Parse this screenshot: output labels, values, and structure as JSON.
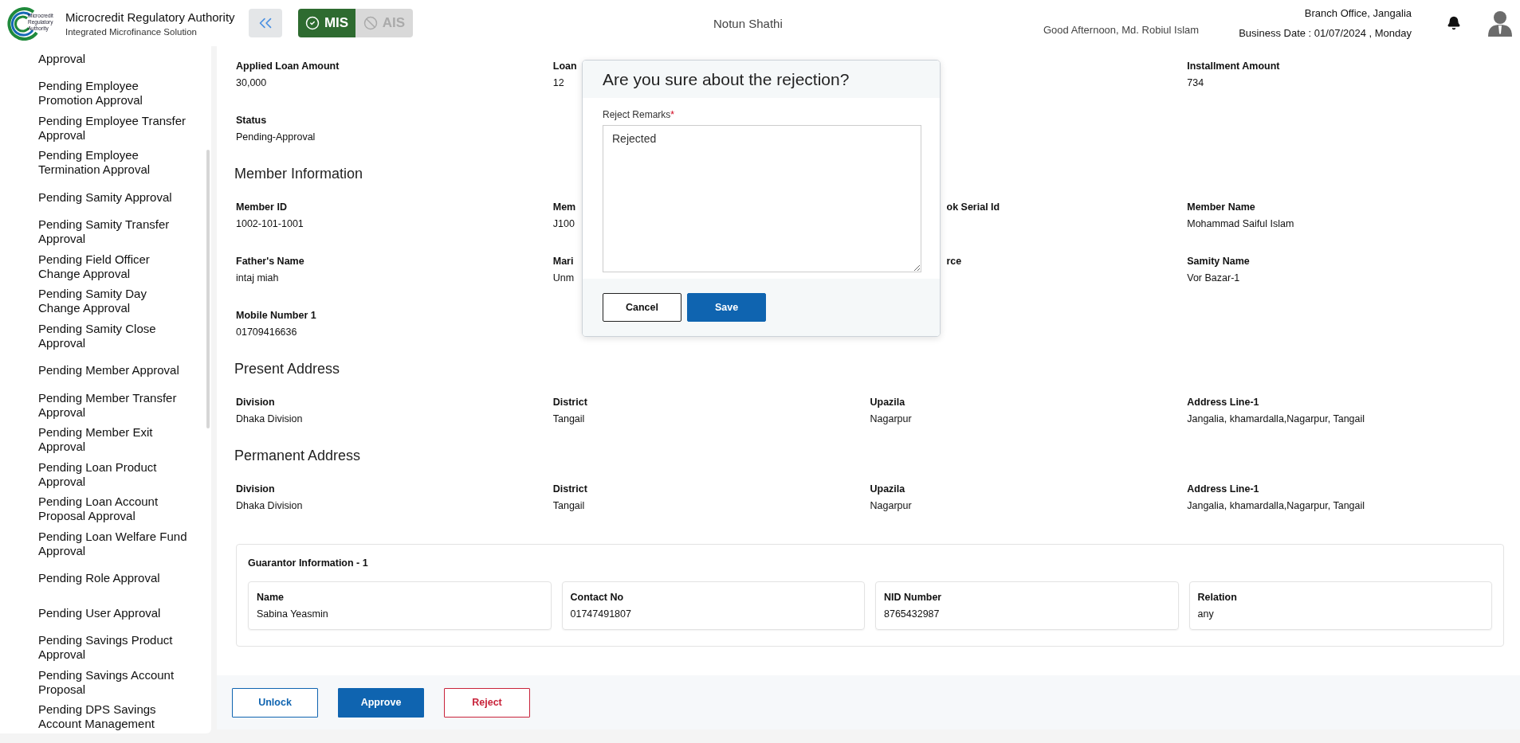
{
  "header": {
    "logo_text": "Microcredit Regulatory Authority",
    "title": "Microcredit Regulatory Authority",
    "subtitle": "Integrated Microfinance Solution",
    "modules": [
      {
        "label": "MIS",
        "selected": true
      },
      {
        "label": "AIS",
        "selected": false
      }
    ],
    "center_title": "Notun Shathi",
    "greeting": "Good Afternoon, Md. Robiul Islam",
    "branch": "Branch Office, Jangalia",
    "business_date": "Business Date : 01/07/2024 , Monday"
  },
  "sidebar": {
    "items": [
      "Approval",
      "Pending Employee Promotion Approval",
      "Pending Employee Transfer Approval",
      "Pending Employee Termination Approval",
      "Pending Samity Approval",
      "Pending Samity Transfer Approval",
      "Pending Field Officer Change Approval",
      "Pending Samity Day Change Approval",
      "Pending Samity Close Approval",
      "Pending Member Approval",
      "Pending Member Transfer Approval",
      "Pending Member Exit Approval",
      "Pending Loan Product Approval",
      "Pending Loan Account Proposal Approval",
      "Pending Loan Welfare Fund Approval",
      "Pending Role Approval",
      "Pending User Approval",
      "Pending Savings Product Approval",
      "Pending Savings Account Proposal",
      "Pending DPS Savings Account Management"
    ]
  },
  "sections": [
    {
      "rows": [
        [
          {
            "kind": "full",
            "label": "Applied Loan Amount",
            "value": "30,000"
          },
          {
            "kind": "cut-right",
            "label": "Loan",
            "value": "12"
          },
          {
            "kind": "hidden"
          },
          {
            "kind": "full",
            "label": "Installment Amount",
            "value": "734"
          }
        ],
        [
          {
            "kind": "full",
            "label": "Status",
            "value": "Pending-Approval"
          }
        ]
      ]
    },
    {
      "heading": "Member Information",
      "rows": [
        [
          {
            "kind": "full",
            "label": "Member ID",
            "value": "1002-101-1001"
          },
          {
            "kind": "cut-right",
            "label": "Mem",
            "value": "J100"
          },
          {
            "kind": "cut-left",
            "label": "ok Serial Id"
          },
          {
            "kind": "full",
            "label": "Member Name",
            "value": "Mohammad Saiful Islam"
          }
        ],
        [
          {
            "kind": "full",
            "label": "Father's Name",
            "value": "intaj miah"
          },
          {
            "kind": "cut-right",
            "label": "Mari",
            "value": "Unm"
          },
          {
            "kind": "cut-left",
            "label": "rce"
          },
          {
            "kind": "full",
            "label": "Samity Name",
            "value": "Vor Bazar-1"
          }
        ],
        [
          {
            "kind": "full",
            "label": "Mobile Number 1",
            "value": "01709416636"
          }
        ]
      ]
    },
    {
      "heading": "Present Address",
      "rows": [
        [
          {
            "kind": "full",
            "label": "Division",
            "value": "Dhaka Division"
          },
          {
            "kind": "full",
            "label": "District",
            "value": "Tangail"
          },
          {
            "kind": "full",
            "label": "Upazila",
            "value": "Nagarpur"
          },
          {
            "kind": "full",
            "label": "Address Line-1",
            "value": "Jangalia, khamardalla,Nagarpur, Tangail"
          }
        ]
      ]
    },
    {
      "heading": "Permanent Address",
      "rows": [
        [
          {
            "kind": "full",
            "label": "Division",
            "value": "Dhaka Division"
          },
          {
            "kind": "full",
            "label": "District",
            "value": "Tangail"
          },
          {
            "kind": "full",
            "label": "Upazila",
            "value": "Nagarpur"
          },
          {
            "kind": "full",
            "label": "Address Line-1",
            "value": "Jangalia, khamardalla,Nagarpur, Tangail"
          }
        ]
      ]
    }
  ],
  "guarantor": {
    "title": "Guarantor Information - 1",
    "fields": [
      {
        "label": "Name",
        "value": "Sabina Yeasmin"
      },
      {
        "label": "Contact No",
        "value": "01747491807"
      },
      {
        "label": "NID Number",
        "value": "8765432987"
      },
      {
        "label": "Relation",
        "value": "any"
      }
    ]
  },
  "actions": [
    {
      "kind": "outline",
      "label": "Unlock"
    },
    {
      "kind": "primary",
      "label": "Approve"
    },
    {
      "kind": "danger",
      "label": "Reject"
    }
  ],
  "dialog": {
    "title": "Are you sure about the rejection?",
    "field_label": "Reject Remarks",
    "required_mark": "*",
    "value": "Rejected",
    "buttons": [
      {
        "kind": "outline",
        "label": "Cancel"
      },
      {
        "kind": "primary",
        "label": "Save"
      }
    ]
  }
}
